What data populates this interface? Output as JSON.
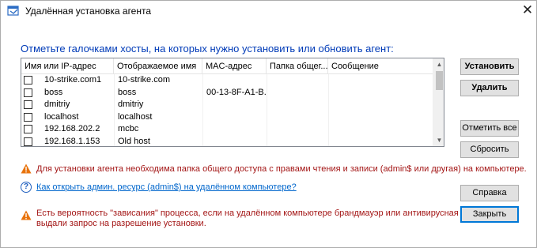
{
  "window": {
    "title": "Удалённая установка агента",
    "close_glyph": "✕"
  },
  "heading": "Отметьте галочками хосты, на которых нужно установить или обновить агент:",
  "table": {
    "columns": [
      "Имя или IP-адрес",
      "Отображаемое имя",
      "MAC-адрес",
      "Папка общег...",
      "Сообщение"
    ],
    "rows": [
      {
        "checked": false,
        "host": "10-strike.com1",
        "display": "10-strike.com",
        "mac": "",
        "folder": "",
        "message": ""
      },
      {
        "checked": false,
        "host": "boss",
        "display": "boss",
        "mac": "00-13-8F-A1-B...",
        "folder": "",
        "message": ""
      },
      {
        "checked": false,
        "host": "dmitriy",
        "display": "dmitriy",
        "mac": "",
        "folder": "",
        "message": ""
      },
      {
        "checked": false,
        "host": "localhost",
        "display": "localhost",
        "mac": "",
        "folder": "",
        "message": ""
      },
      {
        "checked": false,
        "host": "192.168.202.2",
        "display": "mcbc",
        "mac": "",
        "folder": "",
        "message": ""
      },
      {
        "checked": false,
        "host": "192.168.1.153",
        "display": "Old host",
        "mac": "",
        "folder": "",
        "message": ""
      }
    ]
  },
  "buttons": {
    "install": "Установить",
    "delete": "Удалить",
    "check_all": "Отметить все",
    "reset": "Сбросить",
    "help": "Справка",
    "close": "Закрыть"
  },
  "messages": {
    "share_warning": "Для установки агента необходима папка общего доступа с правами чтения и записи (admin$ или другая) на компьютере.",
    "help_link": "Как открыть админ. ресурс (admin$) на удалённом компьютере?",
    "hang_warning_line1": "Есть вероятность \"зависания\" процесса, если на удалённом компьютере брандмауэр или антивирусная программа",
    "hang_warning_line2": "выдали запрос на разрешение установки."
  },
  "colors": {
    "heading": "#003bb8",
    "warning_text": "#a31515",
    "link": "#0066cc",
    "warning_icon": "#e8730c",
    "default_button_border": "#0078d7"
  },
  "icons": {
    "app": "app-window-icon",
    "warning": "warning-triangle-icon",
    "help": "help-circle-icon"
  }
}
